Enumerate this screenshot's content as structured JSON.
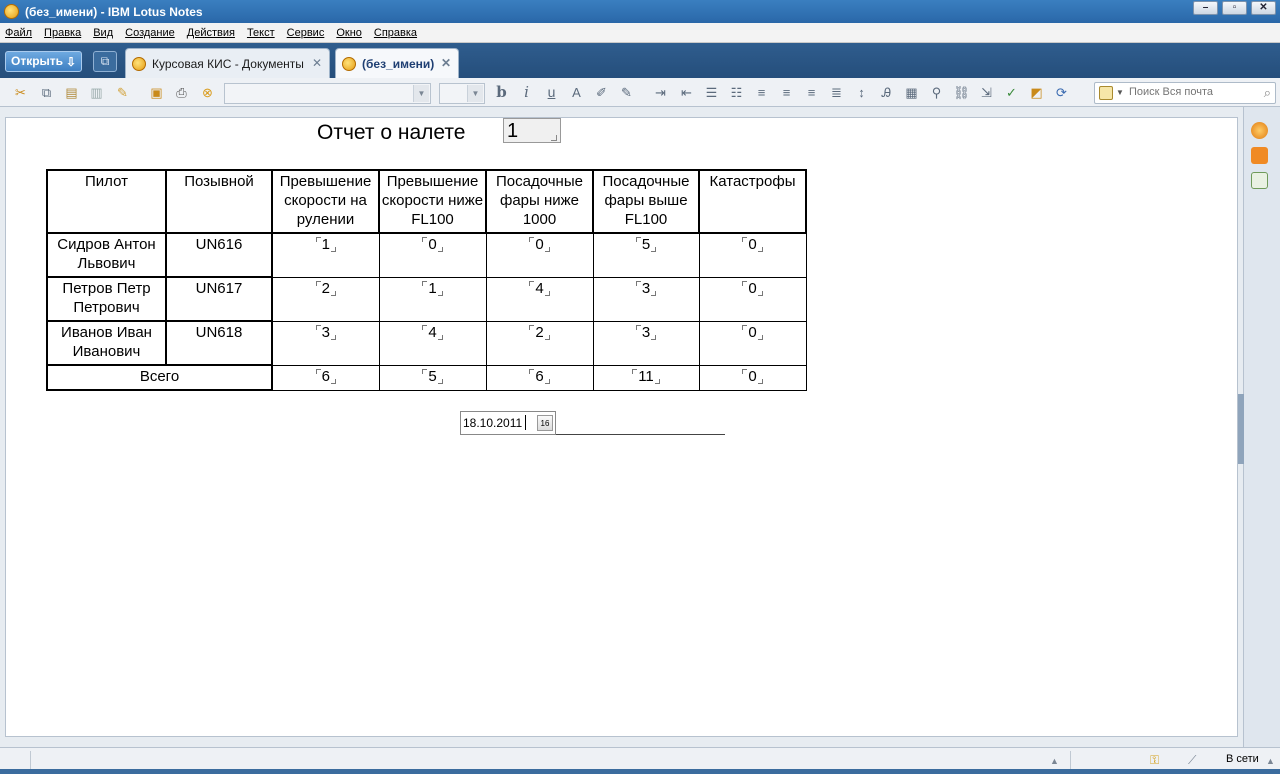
{
  "window": {
    "title": "(без_имени) - IBM Lotus Notes"
  },
  "menu": [
    "Файл",
    "Правка",
    "Вид",
    "Создание",
    "Действия",
    "Текст",
    "Сервис",
    "Окно",
    "Справка"
  ],
  "tabbar": {
    "open_label": "Открыть",
    "tabs": [
      {
        "label": "Курсовая КИС - Документы"
      },
      {
        "label": "(без_имени)"
      }
    ]
  },
  "search": {
    "placeholder": "Поиск Вся почта"
  },
  "form": {
    "title": "Отчет о налете",
    "number": "1",
    "headers": [
      "Пилот",
      "Позывной",
      "Превышение скорости на рулении",
      "Превышение скорости ниже FL100",
      "Посадочные фары ниже 1000",
      "Посадочные фары выше FL100",
      "Катастрофы"
    ],
    "rows": [
      {
        "pilot": "Сидров Антон Львович",
        "callsign": "UN616",
        "values": [
          "1",
          "0",
          "0",
          "5",
          "0"
        ]
      },
      {
        "pilot": "Петров Петр Петрович",
        "callsign": "UN617",
        "values": [
          "2",
          "1",
          "4",
          "3",
          "0"
        ]
      },
      {
        "pilot": "Иванов Иван Иванович",
        "callsign": "UN618",
        "values": [
          "3",
          "4",
          "2",
          "3",
          "0"
        ]
      }
    ],
    "total_label": "Всего",
    "totals": [
      "6",
      "5",
      "6",
      "11",
      "0"
    ],
    "date": "18.10.2011",
    "calendar_label": "16"
  },
  "status": {
    "online": "В сети"
  }
}
